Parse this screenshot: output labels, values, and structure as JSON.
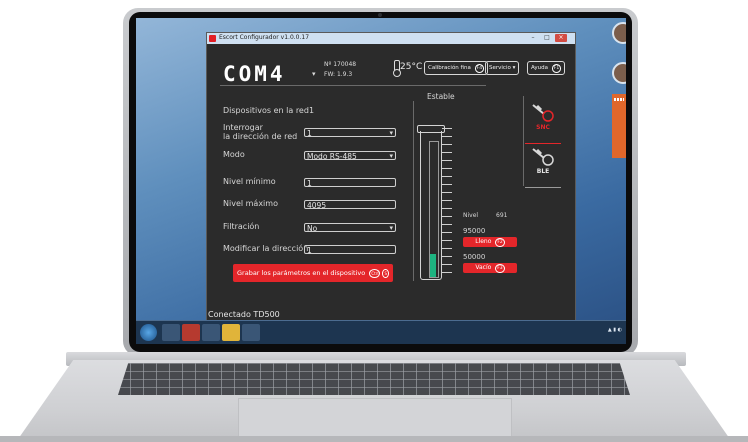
{
  "app": {
    "window_title": "Escort Configurador v1.0.0.17"
  },
  "header": {
    "port": "COM4",
    "serial": "Nº  170048",
    "firmware": "FW: 1.9.3",
    "temperature": "25°C",
    "calibration_button": "Calibración fina",
    "calibration_key": "F4",
    "service_button": "Servicio",
    "service_suffix": "▾",
    "help_button": "Ayuda",
    "help_key": "F1"
  },
  "form": {
    "devices_label": "Dispositivos en la red",
    "devices_value": "1",
    "poll_label_line1": "Interrogar",
    "poll_label_line2": "la dirección de red",
    "poll_value": "1",
    "mode_label": "Modo",
    "mode_value": "Modo RS-485",
    "min_label": "Nivel mínimo",
    "min_value": "1",
    "max_label": "Nivel máximo",
    "max_value": "4095",
    "filter_label": "Filtración",
    "filter_value": "No",
    "address_label": "Modificar la dirección",
    "address_value": "1",
    "save_button": "Grabar los parámetros en el dispositivo",
    "save_key_mod": "Ctrl",
    "save_key": "S"
  },
  "gauge": {
    "state": "Estable",
    "level_label": "Nivel",
    "level_value": "691",
    "level_fraction": 0.17,
    "full_value": "95000",
    "full_button": "Lleno",
    "full_key": "F2",
    "empty_value": "50000",
    "empty_button": "Vacío",
    "empty_key": "F3"
  },
  "probes": [
    {
      "label": "SNC",
      "icon": "probe-icon",
      "color": "#e4262a"
    },
    {
      "label": "BLE",
      "icon": "probe-icon",
      "color": "#e8e8e8"
    }
  ],
  "status": {
    "text": "Conectado TD500"
  },
  "colors": {
    "accent": "#e4262a",
    "level_fill": "#1db380",
    "window_bg": "#2b2b2b"
  }
}
